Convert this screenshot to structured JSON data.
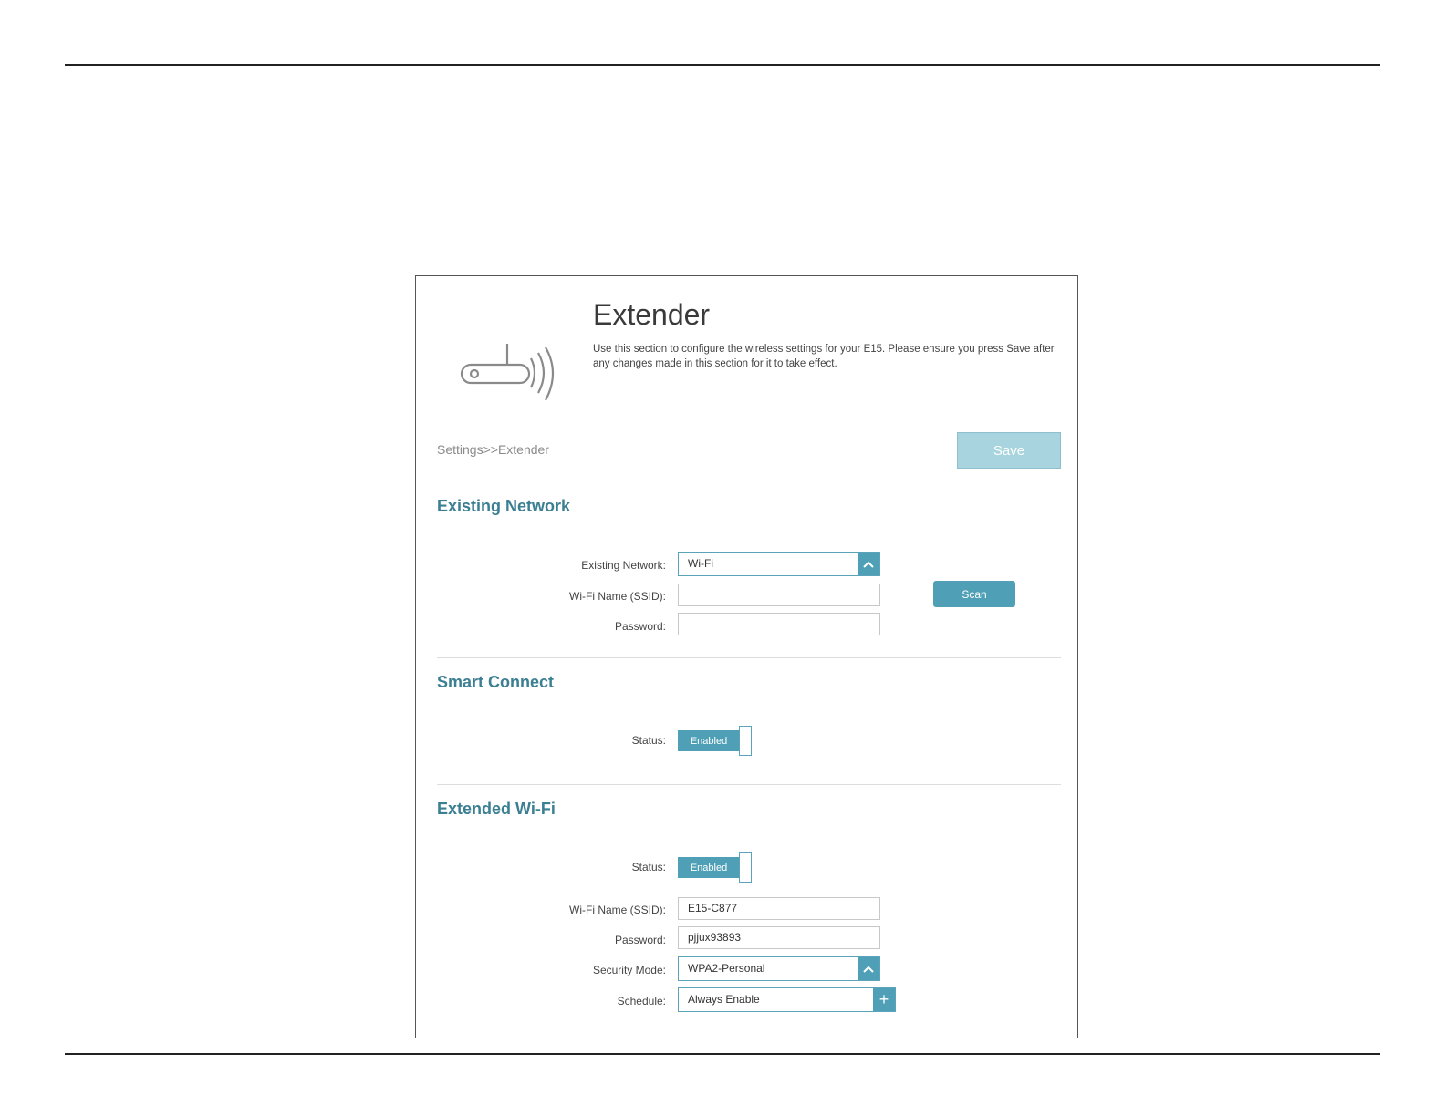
{
  "page": {
    "title": "Extender",
    "description": "Use this section to configure the wireless settings for your E15. Please ensure you press Save after any changes made in this section for it to take effect.",
    "breadcrumb": "Settings>>Extender",
    "save_label": "Save"
  },
  "existing_network": {
    "heading": "Existing Network",
    "network_label": "Existing Network:",
    "network_value": "Wi-Fi",
    "ssid_label": "Wi-Fi Name (SSID):",
    "ssid_value": "",
    "password_label": "Password:",
    "password_value": "",
    "scan_label": "Scan"
  },
  "smart_connect": {
    "heading": "Smart Connect",
    "status_label": "Status:",
    "status_value": "Enabled"
  },
  "extended_wifi": {
    "heading": "Extended Wi-Fi",
    "status_label": "Status:",
    "status_value": "Enabled",
    "ssid_label": "Wi-Fi Name (SSID):",
    "ssid_value": "E15-C877",
    "password_label": "Password:",
    "password_value": "pjjux93893",
    "security_label": "Security Mode:",
    "security_value": "WPA2-Personal",
    "schedule_label": "Schedule:",
    "schedule_value": "Always Enable"
  },
  "colors": {
    "accent": "#4fa0b7",
    "heading": "#3b7f92",
    "save_button": "#a8d4df"
  },
  "icons": [
    "extender-device-icon",
    "chevron-up-icon",
    "plus-icon"
  ]
}
